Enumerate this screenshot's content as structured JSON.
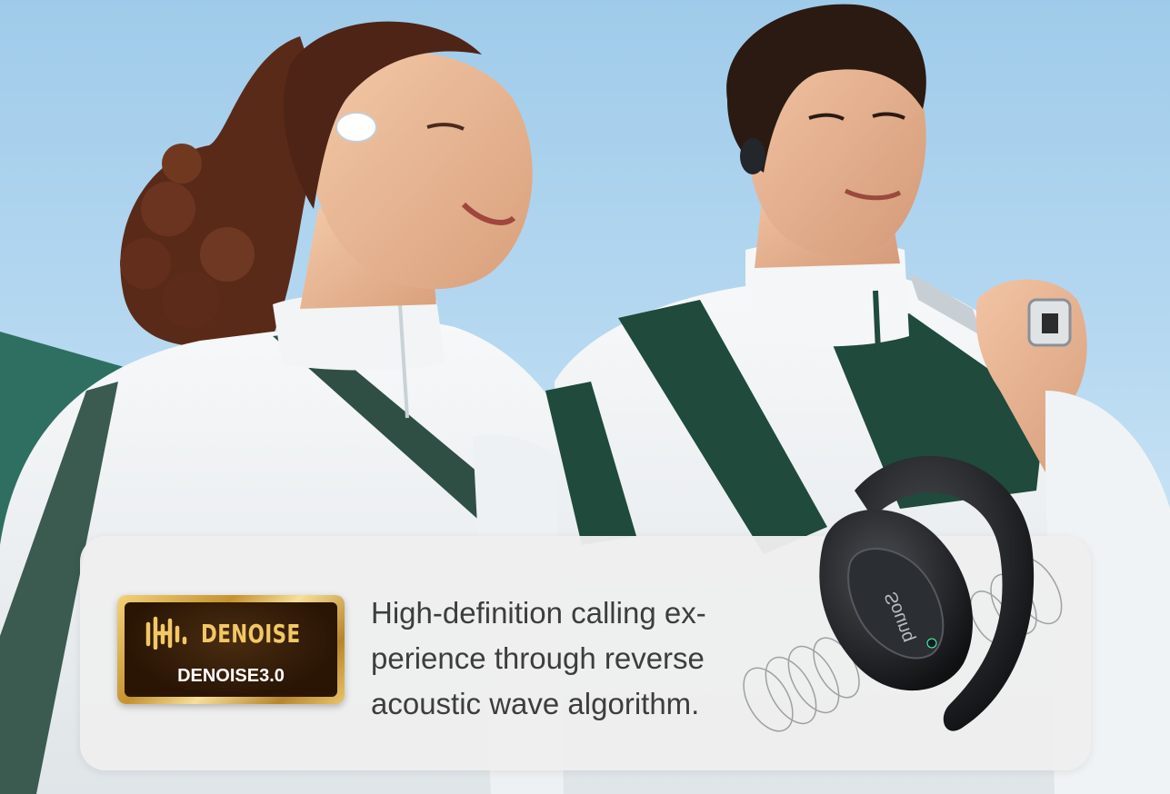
{
  "badge": {
    "icon": "sound-wave-icon",
    "title": "DENOISE",
    "subtitle": "DENOISE3.0"
  },
  "description": {
    "lines": [
      "High-definition calling ex-",
      "perience through reverse",
      "acoustic wave algorithm."
    ]
  },
  "product": {
    "brand_mark": "Sounq"
  },
  "colors": {
    "sky": "#b7d9f1",
    "jacket_white": "#f2f4f5",
    "jacket_green": "#1f4a3c",
    "card": "#eeeeee",
    "badge_gold": "#f1c865",
    "badge_dark": "#2a1505",
    "text": "#3d3d3d"
  }
}
